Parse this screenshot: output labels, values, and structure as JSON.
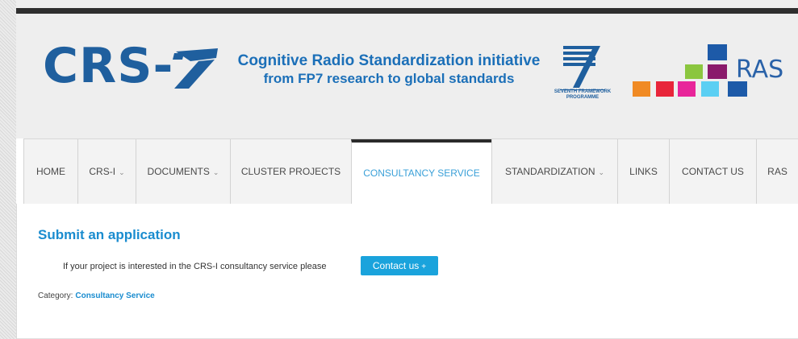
{
  "header": {
    "logo_text": "CRS-",
    "tagline_line1": "Cognitive Radio Standardization initiative",
    "tagline_line2": "from FP7 research to global standards",
    "fp7_label_1": "SEVENTH FRAMEWORK",
    "fp7_label_2": "PROGRAMME",
    "ras_text": "RAS"
  },
  "nav": {
    "items": [
      {
        "label": "HOME"
      },
      {
        "label": "CRS-I",
        "chevron": "⌄"
      },
      {
        "label": "DOCUMENTS",
        "chevron": "⌄"
      },
      {
        "label": "CLUSTER PROJECTS"
      },
      {
        "label": "CONSULTANCY SERVICE"
      },
      {
        "label": "STANDARDIZATION",
        "chevron": "⌄"
      },
      {
        "label": "LINKS"
      },
      {
        "label": "CONTACT US"
      },
      {
        "label": "RAS"
      }
    ]
  },
  "content": {
    "title": "Submit an application",
    "paragraph": "If your project is interested in the CRS-I consultancy service please",
    "button_label": "Contact us",
    "button_icon": "+",
    "category_label": "Category:",
    "category_value": "Consultancy Service"
  },
  "colors": {
    "brand_blue": "#1f5f9e",
    "accent_blue": "#1aa3dc",
    "link_blue": "#1a8ccf",
    "ras_orange": "#f08a24",
    "ras_red": "#e8253a",
    "ras_pink": "#e8259a",
    "ras_cyan": "#5bcff3",
    "ras_green": "#8bc63f",
    "ras_purple": "#8a1a6b",
    "ras_navy": "#1d5aa8"
  }
}
